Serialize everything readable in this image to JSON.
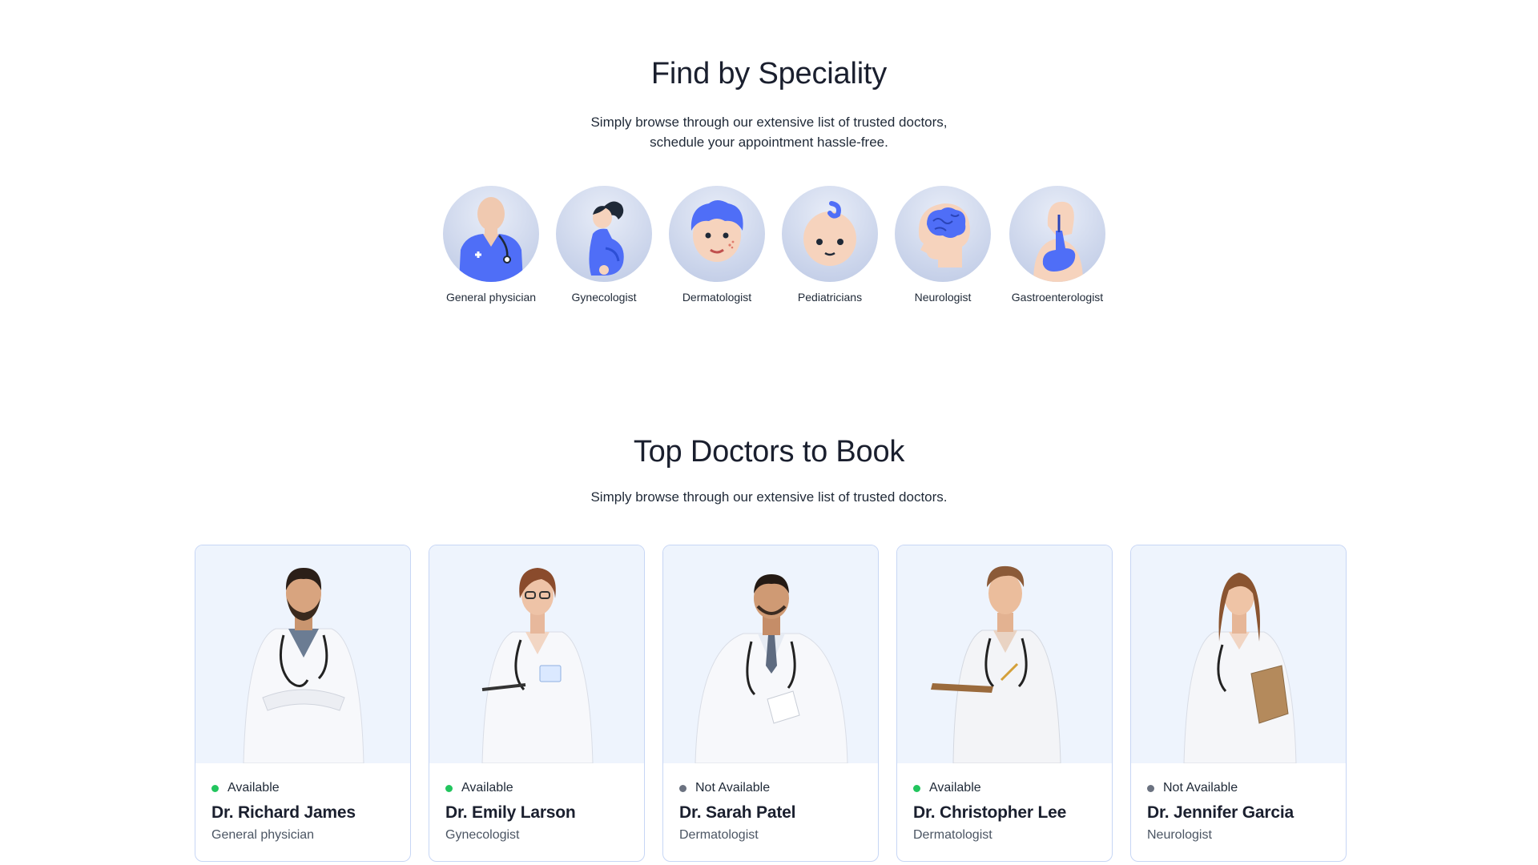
{
  "speciality": {
    "title": "Find by Speciality",
    "subtitle_line1": "Simply browse through our extensive list of trusted doctors,",
    "subtitle_line2": "schedule your appointment hassle-free.",
    "items": [
      {
        "label": "General physician",
        "icon": "general-physician-icon"
      },
      {
        "label": "Gynecologist",
        "icon": "gynecologist-icon"
      },
      {
        "label": "Dermatologist",
        "icon": "dermatologist-icon"
      },
      {
        "label": "Pediatricians",
        "icon": "pediatrician-icon"
      },
      {
        "label": "Neurologist",
        "icon": "neurologist-icon"
      },
      {
        "label": "Gastroenterologist",
        "icon": "gastroenterologist-icon"
      }
    ]
  },
  "top_doctors": {
    "title": "Top Doctors to Book",
    "subtitle": "Simply browse through our extensive list of trusted doctors.",
    "doctors": [
      {
        "status": "Available",
        "name": "Dr. Richard James",
        "speciality": "General physician"
      },
      {
        "status": "Available",
        "name": "Dr. Emily Larson",
        "speciality": "Gynecologist"
      },
      {
        "status": "Not Available",
        "name": "Dr. Sarah Patel",
        "speciality": "Dermatologist"
      },
      {
        "status": "Available",
        "name": "Dr. Christopher Lee",
        "speciality": "Dermatologist"
      },
      {
        "status": "Not Available",
        "name": "Dr. Jennifer Garcia",
        "speciality": "Neurologist"
      }
    ]
  },
  "colors": {
    "available": "#22c55e",
    "not_available": "#6b7280",
    "accent": "#4f6ef7",
    "card_border": "#c7d6f5",
    "photo_bg": "#eef4fd"
  }
}
